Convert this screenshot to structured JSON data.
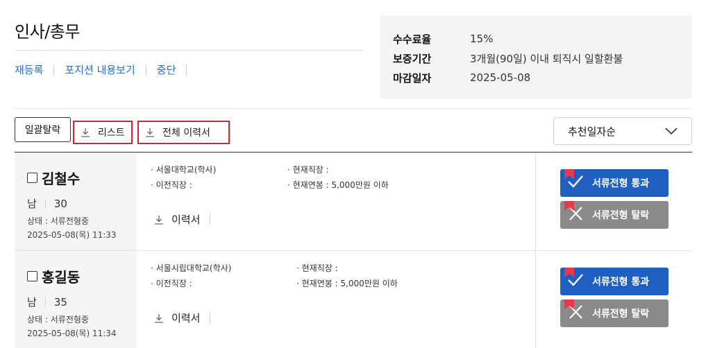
{
  "page": {
    "title": "인사/총무"
  },
  "actions": [
    "재등록",
    "포지션 내용보기",
    "중단"
  ],
  "info": [
    {
      "key": "수수료율",
      "value": "15%"
    },
    {
      "key": "보증기간",
      "value": "3개월(90일) 이내 퇴직시 일할환불"
    },
    {
      "key": "마감일자",
      "value": "2025-05-08"
    }
  ],
  "toolbar": {
    "bulk_reject": "일괄탈락",
    "download_list": "리스트",
    "download_all_resumes": "전체 이력서",
    "sort_selected": "추천일자순"
  },
  "candidates": [
    {
      "name": "김철수",
      "gender": "남",
      "age": "30",
      "status": "상태 : 서류전형중",
      "date": "2025-05-08(목) 11:33",
      "education": "· 서울대학교(학사)",
      "prev_job": "· 이전직장 :",
      "current_job": "· 현재직장 :",
      "salary": "· 현재연봉 : 5,000만원 이하",
      "resume": "이력서",
      "pass_label": "서류전형 통과",
      "fail_label": "서류전형 탈락"
    },
    {
      "name": "홍길동",
      "gender": "남",
      "age": "35",
      "status": "상태 : 서류전형중",
      "date": "2025-05-08(목) 11:34",
      "education": "· 서울시립대학교(학사)",
      "prev_job": "· 이전직장 :",
      "current_job": "· 현재직장 :",
      "salary": "· 현재연봉 : 5,000만원 이하",
      "resume": "이력서",
      "pass_label": "서류전형 통과",
      "fail_label": "서류전형 탈락"
    }
  ],
  "icons": {
    "download": "download-icon",
    "chevron": "chevron-down-icon",
    "check": "check-icon",
    "close": "close-icon",
    "flag": "bookmark-flag-icon"
  },
  "colors": {
    "link": "#1e6fd0",
    "highlight_border": "#d8232a",
    "pass_button": "#1f5fc2",
    "fail_button": "#8a8a8a",
    "flag": "#e8384f"
  }
}
